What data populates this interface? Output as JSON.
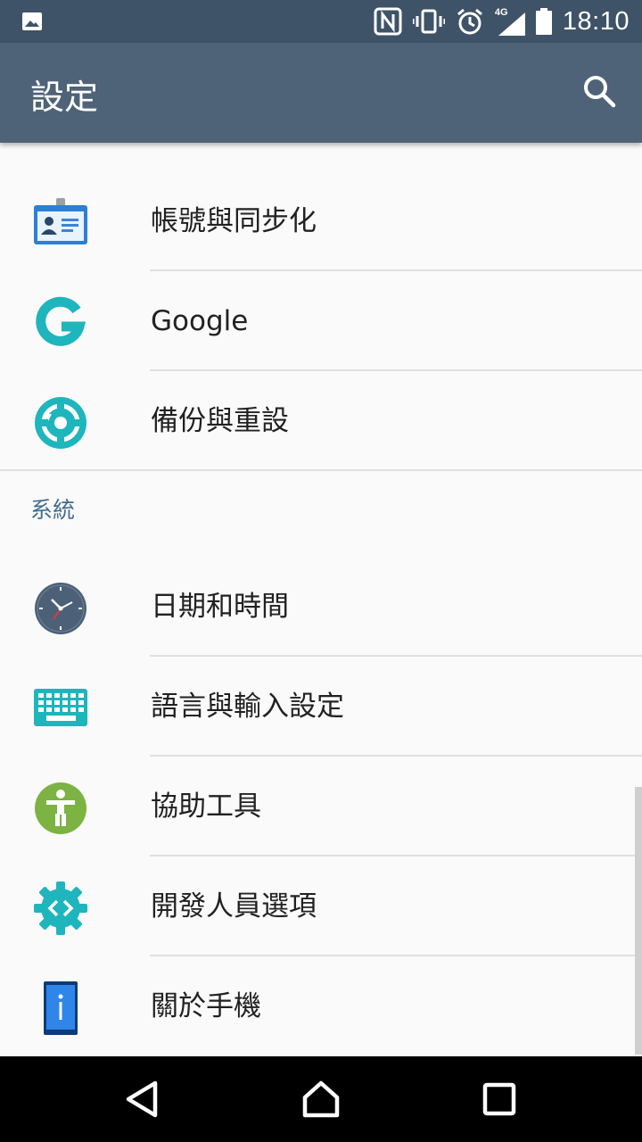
{
  "status_bar": {
    "time": "18:10",
    "network_label": "4G",
    "icons": [
      "image-notification-icon",
      "nfc-icon",
      "vibrate-icon",
      "alarm-icon",
      "signal-icon",
      "battery-icon"
    ]
  },
  "app_bar": {
    "title": "設定",
    "search_icon": "search-icon"
  },
  "list": {
    "items_top": [
      {
        "label": "帳號與同步化",
        "icon": "account-card-icon"
      },
      {
        "label": "Google",
        "icon": "google-icon"
      },
      {
        "label": "備份與重設",
        "icon": "backup-reset-icon"
      }
    ],
    "section_header": "系統",
    "items_system": [
      {
        "label": "日期和時間",
        "icon": "clock-icon"
      },
      {
        "label": "語言與輸入設定",
        "icon": "keyboard-icon"
      },
      {
        "label": "協助工具",
        "icon": "accessibility-icon"
      },
      {
        "label": "開發人員選項",
        "icon": "developer-options-icon"
      },
      {
        "label": "關於手機",
        "icon": "phone-info-icon"
      }
    ]
  },
  "colors": {
    "status_bar": "#3e5367",
    "app_bar": "#4f6378",
    "section_header": "#3f6d8f",
    "teal_accent": "#1fb5bd"
  }
}
